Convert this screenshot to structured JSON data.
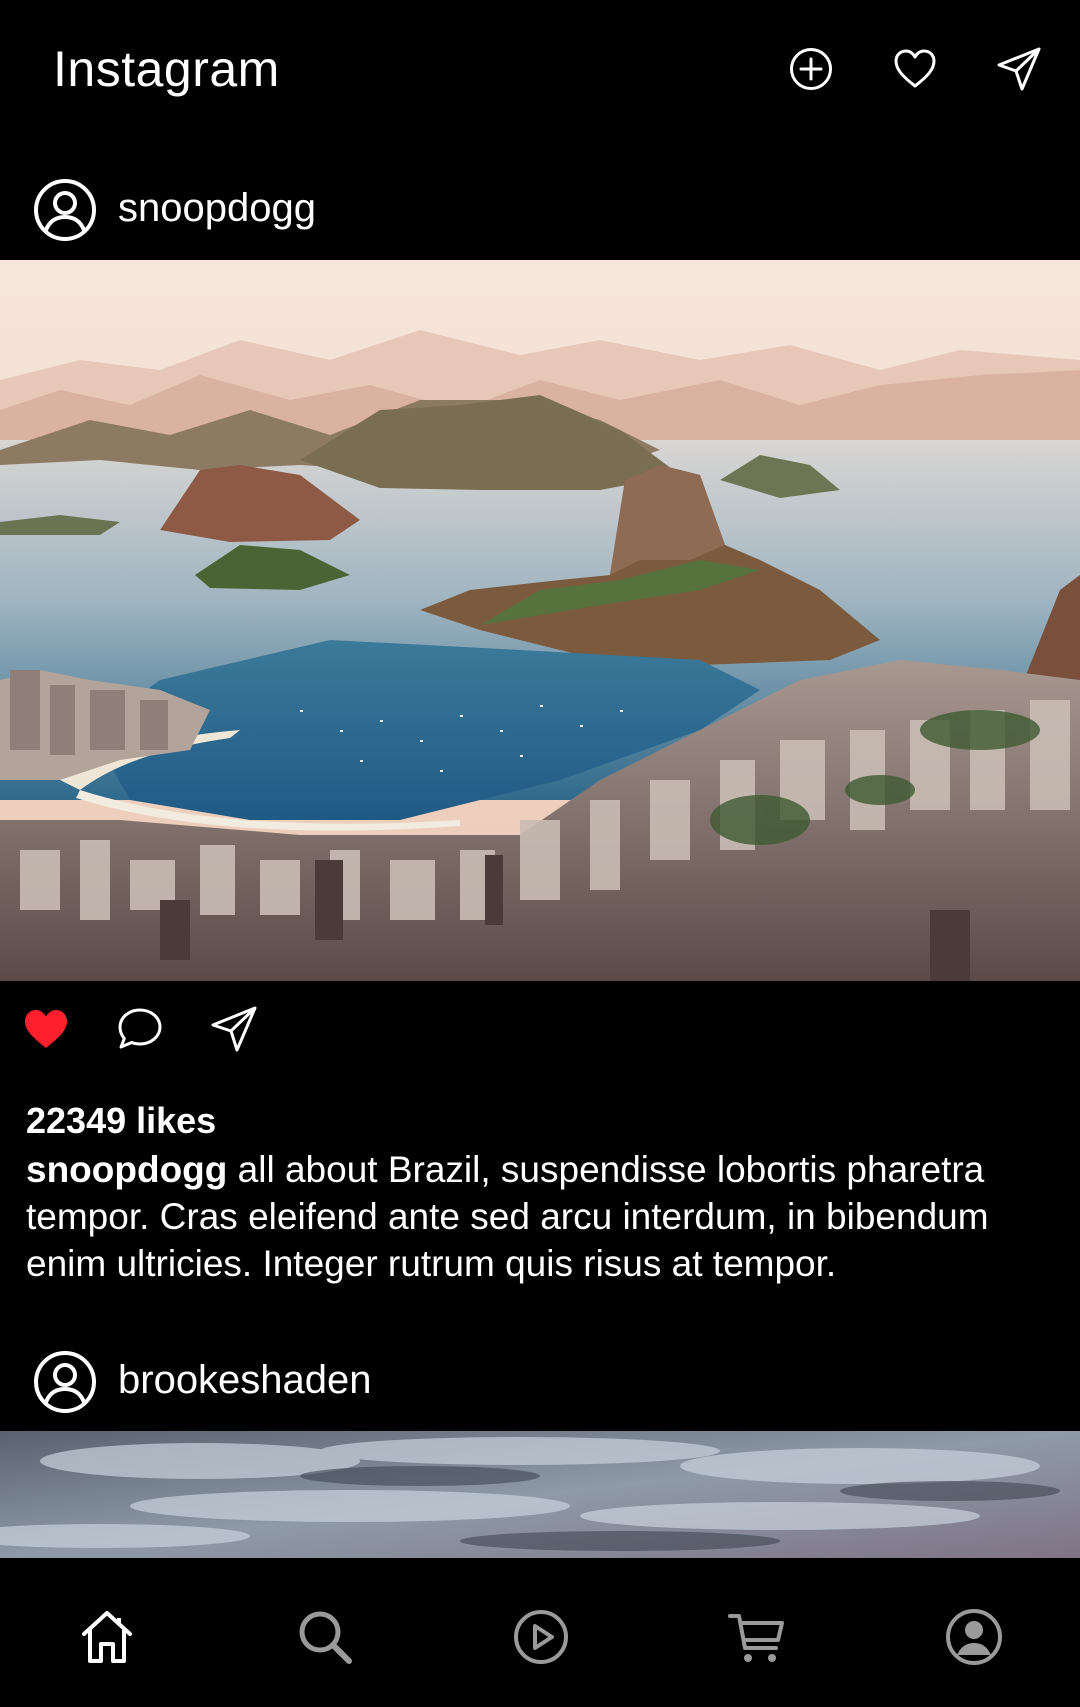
{
  "app": {
    "title": "Instagram"
  },
  "top_actions": [
    {
      "name": "new-post-button",
      "icon": "plus-circle-icon"
    },
    {
      "name": "activity-button",
      "icon": "heart-icon"
    },
    {
      "name": "direct-messages-button",
      "icon": "send-icon"
    }
  ],
  "posts": [
    {
      "username": "snoopdogg",
      "liked": true,
      "likes_label": "22349 likes",
      "caption_user": "snoopdogg",
      "caption_text": " all about Brazil, suspendisse lobortis pharetra tempor. Cras eleifend ante sed arcu interdum, in bibendum enim ultricies. Integer rutrum quis risus at tempor."
    },
    {
      "username": "brookeshaden"
    }
  ],
  "bottom_nav": [
    {
      "name": "home",
      "icon": "home-icon",
      "active": true
    },
    {
      "name": "search",
      "icon": "search-icon",
      "active": false
    },
    {
      "name": "reels",
      "icon": "play-circle-icon",
      "active": false
    },
    {
      "name": "shop",
      "icon": "cart-icon",
      "active": false
    },
    {
      "name": "profile",
      "icon": "profile-icon",
      "active": false
    }
  ],
  "colors": {
    "background": "#000000",
    "text": "#ffffff",
    "like_active": "#ff1f2d",
    "nav_inactive": "#9a9a9a"
  }
}
